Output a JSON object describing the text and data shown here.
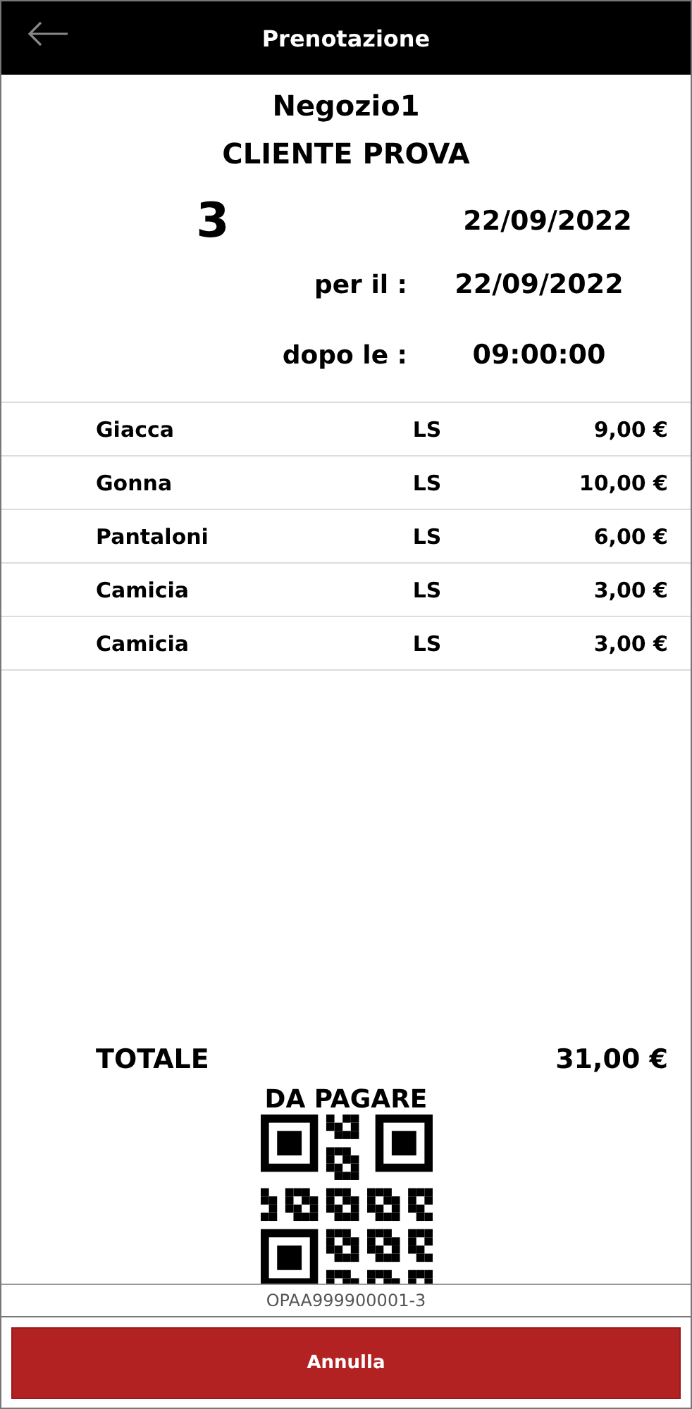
{
  "header": {
    "title": "Prenotazione"
  },
  "shop": "Negozio1",
  "customer": "CLIENTE PROVA",
  "number": "3",
  "date": "22/09/2022",
  "details": [
    {
      "label": "per il :",
      "value": "22/09/2022"
    },
    {
      "label": "dopo le :",
      "value": "09:00:00"
    }
  ],
  "items": [
    {
      "name": "Giacca",
      "code": "LS",
      "price": "9,00 €"
    },
    {
      "name": "Gonna",
      "code": "LS",
      "price": "10,00 €"
    },
    {
      "name": "Pantaloni",
      "code": "LS",
      "price": "6,00 €"
    },
    {
      "name": "Camicia",
      "code": "LS",
      "price": "3,00 €"
    },
    {
      "name": "Camicia",
      "code": "LS",
      "price": "3,00 €"
    }
  ],
  "total": {
    "label": "TOTALE",
    "value": "31,00 €"
  },
  "payment_status": "DA PAGARE",
  "barcode_text": "OPAA999900001-3",
  "buttons": [
    "Annulla"
  ]
}
